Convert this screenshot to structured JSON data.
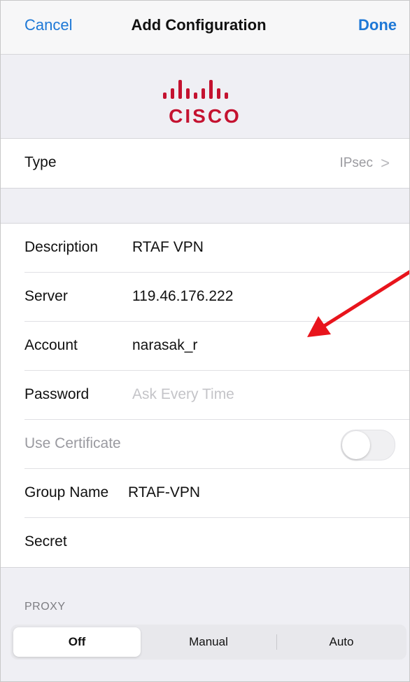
{
  "navbar": {
    "cancel_label": "Cancel",
    "title": "Add Configuration",
    "done_label": "Done"
  },
  "logo": {
    "brand": "CISCO",
    "color": "#c41230",
    "bars_color": "#c41230"
  },
  "type_row": {
    "label": "Type",
    "value": "IPsec",
    "chevron": ">"
  },
  "fields": {
    "description": {
      "label": "Description",
      "value": "RTAF VPN"
    },
    "server": {
      "label": "Server",
      "value": "119.46.176.222"
    },
    "account": {
      "label": "Account",
      "value": "narasak_r"
    },
    "password": {
      "label": "Password",
      "placeholder": "Ask Every Time"
    },
    "use_certificate": {
      "label": "Use Certificate",
      "enabled": false
    },
    "group_name": {
      "label": "Group Name",
      "value": "RTAF-VPN"
    },
    "secret": {
      "label": "Secret",
      "value": ""
    }
  },
  "proxy": {
    "header": "PROXY",
    "options": [
      "Off",
      "Manual",
      "Auto"
    ],
    "selected": "Off"
  },
  "annotation": {
    "arrow_color": "#e8141c"
  },
  "colors": {
    "accent": "#1e78d6",
    "background": "#efeff4"
  }
}
